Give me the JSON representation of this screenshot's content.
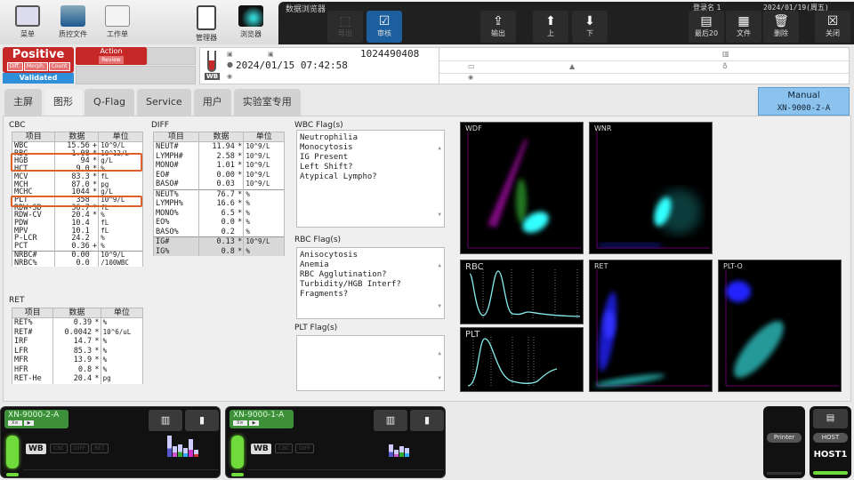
{
  "toolbar": {
    "left_buttons": [
      {
        "label": "菜单",
        "icon": "menu-grid-icon"
      },
      {
        "label": "质控文件",
        "icon": "qc-folder-icon"
      },
      {
        "label": "工作单",
        "icon": "worklist-icon"
      },
      {
        "label": "管理器",
        "icon": "manager-clipboard-icon"
      },
      {
        "label": "浏览器",
        "icon": "browser-scatter-icon"
      }
    ],
    "browser_title": "数据浏览器",
    "login": "登录名 1",
    "datetime": "2024/01/19(周五) 14:09",
    "buttons": [
      {
        "label": "导出",
        "glyph": "⬚",
        "icon": "export-icon"
      },
      {
        "label": "审核",
        "glyph": "☑",
        "icon": "validate-check-icon"
      },
      {
        "label": "输出",
        "glyph": "⇪",
        "icon": "output-icon"
      },
      {
        "label": "上",
        "glyph": "⬆",
        "icon": "arrow-up-icon"
      },
      {
        "label": "下",
        "glyph": "⬇",
        "icon": "arrow-down-icon"
      },
      {
        "label": "最后20",
        "glyph": "▤",
        "icon": "last20-icon"
      },
      {
        "label": "文件",
        "glyph": "▦",
        "icon": "file-icon"
      },
      {
        "label": "删除",
        "glyph": "🗑",
        "icon": "trash-icon"
      },
      {
        "label": "关闭",
        "glyph": "☒",
        "icon": "close-icon"
      }
    ]
  },
  "status": {
    "positive": "Positive",
    "positive_chips": [
      "Diff.",
      "Morph.",
      "Count"
    ],
    "validated": "Validated",
    "action": "Action",
    "action_sub": "Review"
  },
  "sample": {
    "tube_label": "WB",
    "sample_no": "1024490408",
    "datetime": "2024/01/15 07:42:58"
  },
  "tabs": [
    "主屏",
    "图形",
    "Q-Flag",
    "Service",
    "用户",
    "实验室专用"
  ],
  "active_tab": "图形",
  "manual": {
    "line1": "Manual",
    "line2": "XN-9000-2-A"
  },
  "headers": [
    "项目",
    "数据",
    "单位"
  ],
  "cbc": {
    "title": "CBC",
    "rows": [
      [
        "WBC",
        "15.56",
        "+",
        "10^9/L"
      ],
      [
        "RBC",
        "1.08",
        "*",
        "10^12/L"
      ],
      [
        "HGB",
        "94",
        "*",
        "g/L"
      ],
      [
        "HCT",
        "9.0",
        "*",
        "%"
      ],
      [
        "MCV",
        "83.3",
        "*",
        "fL"
      ],
      [
        "MCH",
        "87.0",
        "*",
        "pg"
      ],
      [
        "MCHC",
        "1044",
        "*",
        "g/L"
      ],
      [
        "PLT",
        "358",
        "",
        "10^9/L"
      ],
      [
        "RDW-SD",
        "36.7",
        "*",
        "fL"
      ],
      [
        "RDW-CV",
        "20.4",
        "*",
        "%"
      ],
      [
        "PDW",
        "10.4",
        "",
        "fL"
      ],
      [
        "MPV",
        "10.1",
        "",
        "fL"
      ],
      [
        "P-LCR",
        "24.2",
        "",
        "%"
      ],
      [
        "PCT",
        "0.36",
        "+",
        "%"
      ],
      [
        "NRBC#",
        "0.00",
        "",
        "10^9/L"
      ],
      [
        "NRBC%",
        "0.0",
        "",
        "/100WBC"
      ]
    ]
  },
  "diff": {
    "title": "DIFF",
    "rows": [
      [
        "NEUT#",
        "11.94",
        "*",
        "10^9/L"
      ],
      [
        "LYMPH#",
        "2.58",
        "*",
        "10^9/L"
      ],
      [
        "MONO#",
        "1.01",
        "*",
        "10^9/L"
      ],
      [
        "EO#",
        "0.00",
        "*",
        "10^9/L"
      ],
      [
        "BASO#",
        "0.03",
        "",
        "10^9/L"
      ],
      [
        "NEUT%",
        "76.7",
        "*",
        "%"
      ],
      [
        "LYMPH%",
        "16.6",
        "*",
        "%"
      ],
      [
        "MONO%",
        "6.5",
        "*",
        "%"
      ],
      [
        "EO%",
        "0.0",
        "*",
        "%"
      ],
      [
        "BASO%",
        "0.2",
        "",
        "%"
      ],
      [
        "IG#",
        "0.13",
        "*",
        "10^9/L"
      ],
      [
        "IG%",
        "0.8",
        "*",
        "%"
      ]
    ]
  },
  "ret": {
    "title": "RET",
    "rows": [
      [
        "RET%",
        "0.39",
        "*",
        "%"
      ],
      [
        "RET#",
        "0.0042",
        "*",
        "10^6/uL"
      ],
      [
        "IRF",
        "14.7",
        "*",
        "%"
      ],
      [
        "LFR",
        "85.3",
        "*",
        "%"
      ],
      [
        "MFR",
        "13.9",
        "*",
        "%"
      ],
      [
        "HFR",
        "0.8",
        "*",
        "%"
      ],
      [
        "RET-He",
        "20.4",
        "*",
        "pg"
      ]
    ]
  },
  "flags": {
    "wbc_title": "WBC Flag(s)",
    "wbc": [
      "Neutrophilia",
      "Monocytosis",
      "IG Present",
      "Left Shift?",
      "Atypical Lympho?"
    ],
    "rbc_title": "RBC Flag(s)",
    "rbc": [
      "Anisocytosis",
      "Anemia",
      "RBC Agglutination?",
      "Turbidity/HGB Interf?",
      "Fragments?"
    ],
    "plt_title": "PLT Flag(s)",
    "plt": []
  },
  "plots": {
    "wdf": "WDF",
    "wnr": "WNR",
    "rbc": "RBC",
    "plt": "PLT",
    "ret": "RET",
    "plto": "PLT-O"
  },
  "analyzers": [
    {
      "name": "XN-9000-2-A",
      "mode": "WB",
      "channels": [
        "CBC",
        "DIFF",
        "RET"
      ]
    },
    {
      "name": "XN-9000-1-A",
      "mode": "WB",
      "channels": [
        "CBC",
        "DIFF"
      ]
    }
  ],
  "printer": "Printer",
  "host": {
    "label": "HOST",
    "name": "HOST1"
  },
  "colors": {
    "positive": "#c62828",
    "validated": "#2f8fd8",
    "highlight": "#e0602a",
    "led": "#6edb3a"
  }
}
